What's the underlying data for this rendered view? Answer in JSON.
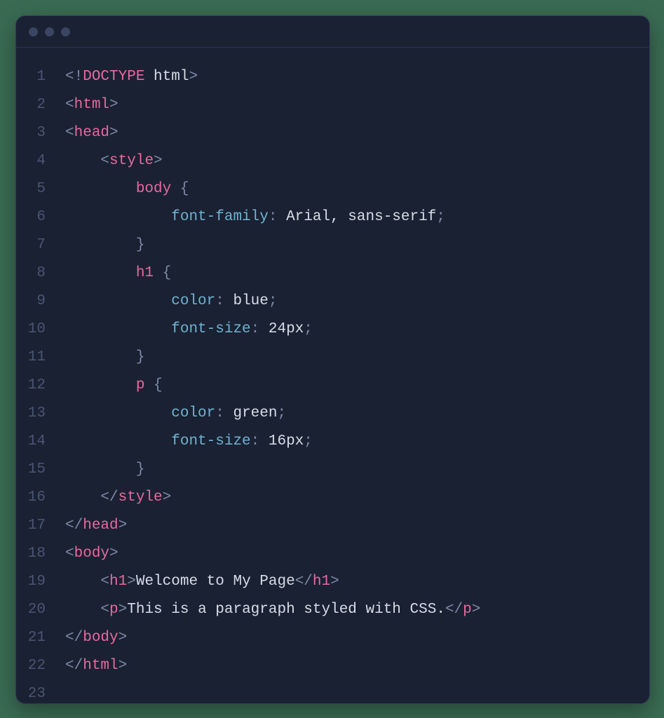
{
  "window": {
    "traffic_light_count": 3
  },
  "code": {
    "line_numbers": [
      "1",
      "2",
      "3",
      "4",
      "5",
      "6",
      "7",
      "8",
      "9",
      "10",
      "11",
      "12",
      "13",
      "14",
      "15",
      "16",
      "17",
      "18",
      "19",
      "20",
      "21",
      "22",
      "23"
    ],
    "lines": [
      {
        "indent": 0,
        "tokens": [
          {
            "c": "punct",
            "t": "<!"
          },
          {
            "c": "doctype",
            "t": "DOCTYPE"
          },
          {
            "c": "text",
            "t": " html"
          },
          {
            "c": "punct",
            "t": ">"
          }
        ]
      },
      {
        "indent": 0,
        "tokens": [
          {
            "c": "punct",
            "t": "<"
          },
          {
            "c": "tag",
            "t": "html"
          },
          {
            "c": "punct",
            "t": ">"
          }
        ]
      },
      {
        "indent": 0,
        "tokens": [
          {
            "c": "punct",
            "t": "<"
          },
          {
            "c": "tag",
            "t": "head"
          },
          {
            "c": "punct",
            "t": ">"
          }
        ]
      },
      {
        "indent": 1,
        "tokens": [
          {
            "c": "punct",
            "t": "<"
          },
          {
            "c": "tag",
            "t": "style"
          },
          {
            "c": "punct",
            "t": ">"
          }
        ]
      },
      {
        "indent": 2,
        "tokens": [
          {
            "c": "sel",
            "t": "body"
          },
          {
            "c": "text",
            "t": " "
          },
          {
            "c": "punct",
            "t": "{"
          }
        ]
      },
      {
        "indent": 3,
        "tokens": [
          {
            "c": "prop",
            "t": "font-family"
          },
          {
            "c": "punct",
            "t": ":"
          },
          {
            "c": "text",
            "t": " "
          },
          {
            "c": "val",
            "t": "Arial, sans-serif"
          },
          {
            "c": "punct",
            "t": ";"
          }
        ]
      },
      {
        "indent": 2,
        "tokens": [
          {
            "c": "punct",
            "t": "}"
          }
        ]
      },
      {
        "indent": 2,
        "tokens": [
          {
            "c": "sel",
            "t": "h1"
          },
          {
            "c": "text",
            "t": " "
          },
          {
            "c": "punct",
            "t": "{"
          }
        ]
      },
      {
        "indent": 3,
        "tokens": [
          {
            "c": "prop",
            "t": "color"
          },
          {
            "c": "punct",
            "t": ":"
          },
          {
            "c": "text",
            "t": " "
          },
          {
            "c": "val",
            "t": "blue"
          },
          {
            "c": "punct",
            "t": ";"
          }
        ]
      },
      {
        "indent": 3,
        "tokens": [
          {
            "c": "prop",
            "t": "font-size"
          },
          {
            "c": "punct",
            "t": ":"
          },
          {
            "c": "text",
            "t": " "
          },
          {
            "c": "val",
            "t": "24px"
          },
          {
            "c": "punct",
            "t": ";"
          }
        ]
      },
      {
        "indent": 2,
        "tokens": [
          {
            "c": "punct",
            "t": "}"
          }
        ]
      },
      {
        "indent": 2,
        "tokens": [
          {
            "c": "sel",
            "t": "p"
          },
          {
            "c": "text",
            "t": " "
          },
          {
            "c": "punct",
            "t": "{"
          }
        ]
      },
      {
        "indent": 3,
        "tokens": [
          {
            "c": "prop",
            "t": "color"
          },
          {
            "c": "punct",
            "t": ":"
          },
          {
            "c": "text",
            "t": " "
          },
          {
            "c": "val",
            "t": "green"
          },
          {
            "c": "punct",
            "t": ";"
          }
        ]
      },
      {
        "indent": 3,
        "tokens": [
          {
            "c": "prop",
            "t": "font-size"
          },
          {
            "c": "punct",
            "t": ":"
          },
          {
            "c": "text",
            "t": " "
          },
          {
            "c": "val",
            "t": "16px"
          },
          {
            "c": "punct",
            "t": ";"
          }
        ]
      },
      {
        "indent": 2,
        "tokens": [
          {
            "c": "punct",
            "t": "}"
          }
        ]
      },
      {
        "indent": 1,
        "tokens": [
          {
            "c": "punct",
            "t": "</"
          },
          {
            "c": "tag",
            "t": "style"
          },
          {
            "c": "punct",
            "t": ">"
          }
        ]
      },
      {
        "indent": 0,
        "tokens": [
          {
            "c": "punct",
            "t": "</"
          },
          {
            "c": "tag",
            "t": "head"
          },
          {
            "c": "punct",
            "t": ">"
          }
        ]
      },
      {
        "indent": 0,
        "tokens": [
          {
            "c": "punct",
            "t": "<"
          },
          {
            "c": "tag",
            "t": "body"
          },
          {
            "c": "punct",
            "t": ">"
          }
        ]
      },
      {
        "indent": 1,
        "tokens": [
          {
            "c": "punct",
            "t": "<"
          },
          {
            "c": "tag",
            "t": "h1"
          },
          {
            "c": "punct",
            "t": ">"
          },
          {
            "c": "text",
            "t": "Welcome to My Page"
          },
          {
            "c": "punct",
            "t": "</"
          },
          {
            "c": "tag",
            "t": "h1"
          },
          {
            "c": "punct",
            "t": ">"
          }
        ]
      },
      {
        "indent": 1,
        "tokens": [
          {
            "c": "punct",
            "t": "<"
          },
          {
            "c": "tag",
            "t": "p"
          },
          {
            "c": "punct",
            "t": ">"
          },
          {
            "c": "text",
            "t": "This is a paragraph styled with CSS."
          },
          {
            "c": "punct",
            "t": "</"
          },
          {
            "c": "tag",
            "t": "p"
          },
          {
            "c": "punct",
            "t": ">"
          }
        ]
      },
      {
        "indent": 0,
        "tokens": [
          {
            "c": "punct",
            "t": "</"
          },
          {
            "c": "tag",
            "t": "body"
          },
          {
            "c": "punct",
            "t": ">"
          }
        ]
      },
      {
        "indent": 0,
        "tokens": [
          {
            "c": "punct",
            "t": "</"
          },
          {
            "c": "tag",
            "t": "html"
          },
          {
            "c": "punct",
            "t": ">"
          }
        ]
      },
      {
        "indent": 0,
        "tokens": []
      }
    ]
  }
}
